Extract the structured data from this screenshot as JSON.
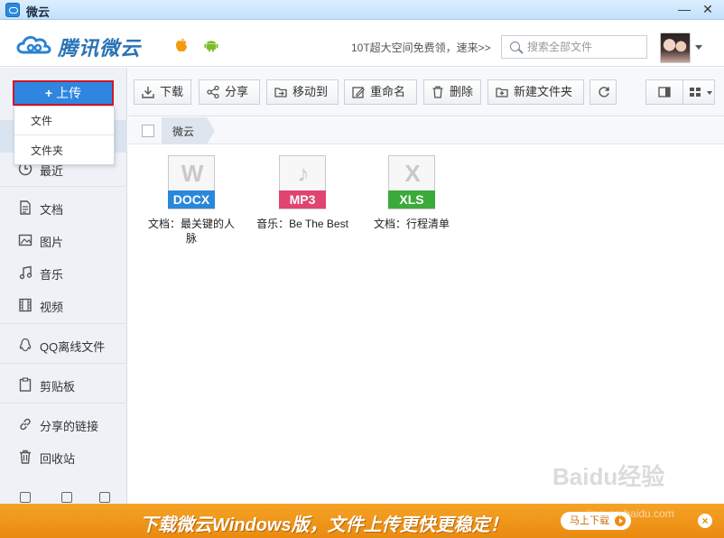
{
  "window": {
    "title": "微云",
    "minimize": "—",
    "close": "✕"
  },
  "header": {
    "logo_text": "腾讯微云",
    "promo": "10T超大空间免费领，速来>>",
    "search_placeholder": "搜索全部文件"
  },
  "sidebar": {
    "upload_label": "上传",
    "upload_plus": "+",
    "dropdown": [
      "文件",
      "文件夹"
    ],
    "items": [
      {
        "label": "最近",
        "icon": "clock-icon"
      },
      {
        "label": "文档",
        "icon": "document-icon"
      },
      {
        "label": "图片",
        "icon": "image-icon"
      },
      {
        "label": "音乐",
        "icon": "music-icon"
      },
      {
        "label": "视频",
        "icon": "video-icon"
      },
      {
        "label": "QQ离线文件",
        "icon": "qq-icon"
      },
      {
        "label": "剪贴板",
        "icon": "clipboard-icon"
      },
      {
        "label": "分享的链接",
        "icon": "link-icon"
      },
      {
        "label": "回收站",
        "icon": "trash-icon"
      }
    ]
  },
  "toolbar": {
    "download": "下载",
    "share": "分享",
    "move": "移动到",
    "rename": "重命名",
    "delete": "删除",
    "new_folder": "新建文件夹"
  },
  "breadcrumb": {
    "current": "微云"
  },
  "files": [
    {
      "type": "DOCX",
      "glyph": "W",
      "name": "文档：最关键的人脉",
      "color": "#2b87d8"
    },
    {
      "type": "MP3",
      "glyph": "♪",
      "name": "音乐：Be The Best",
      "color": "#e0456f"
    },
    {
      "type": "XLS",
      "glyph": "X",
      "name": "文档：行程清单",
      "color": "#3aab3a"
    }
  ],
  "banner": {
    "text": "下载微云Windows版，文件上传更快更稳定！",
    "button": "马上下载",
    "close": "×"
  },
  "watermark": "Baidu经验",
  "watermark_sub": "jingyan.baidu.com"
}
